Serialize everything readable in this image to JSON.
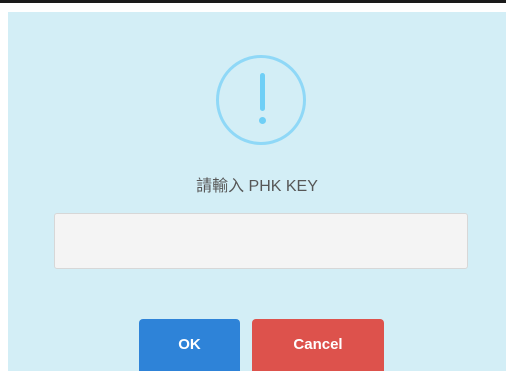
{
  "dialog": {
    "icon": "exclamation-icon",
    "prompt": "請輸入 PHK KEY",
    "input": {
      "value": "",
      "placeholder": ""
    },
    "buttons": {
      "ok_label": "OK",
      "cancel_label": "Cancel"
    },
    "colors": {
      "background": "#d3eef6",
      "icon": "#8fd8f7",
      "ok": "#2e83d8",
      "cancel": "#dd524c"
    }
  }
}
